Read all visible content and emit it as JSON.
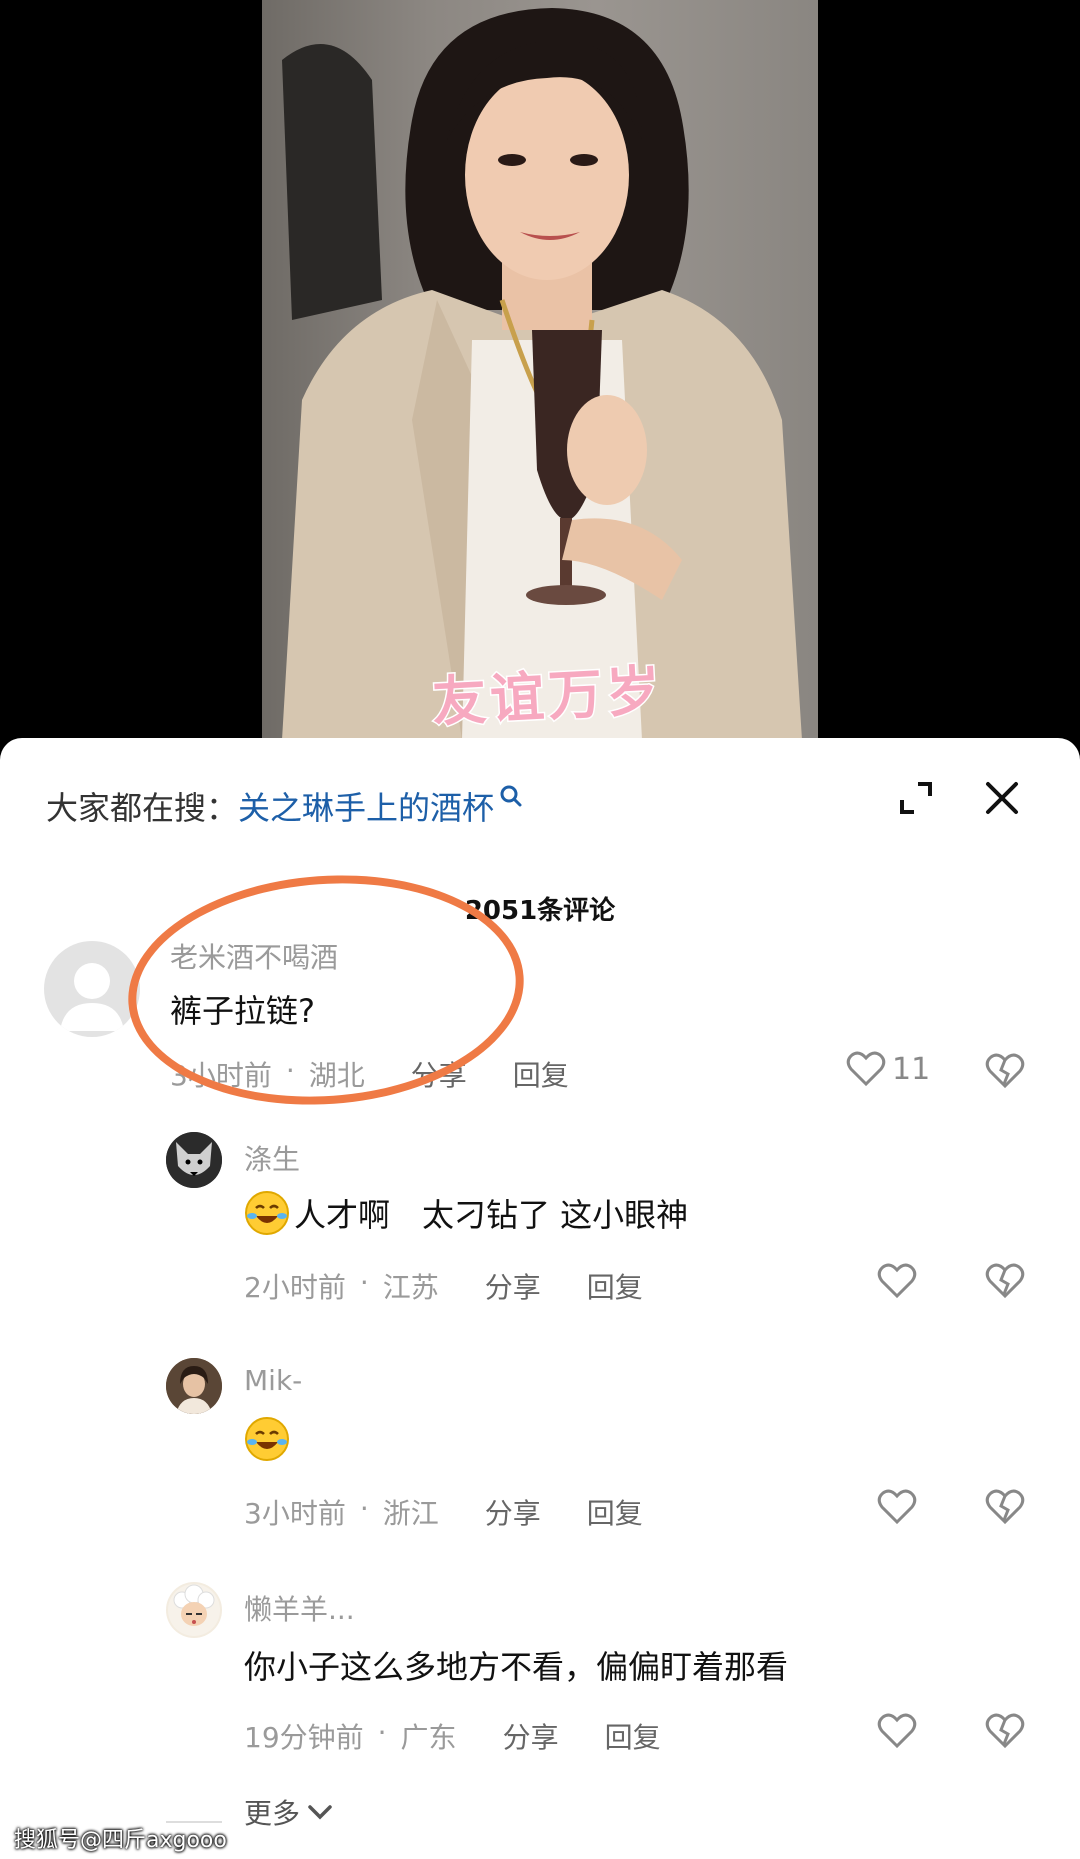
{
  "video": {
    "caption": "友谊万岁"
  },
  "search": {
    "prefix": "大家都在搜：",
    "query": "关之琳手上的酒杯"
  },
  "comments_count": "2051条评论",
  "comments": [
    {
      "user": "老米酒不喝酒",
      "text": "裤子拉链?",
      "time": "3小时前",
      "region": "湖北",
      "share": "分享",
      "reply": "回复",
      "likes": "11"
    },
    {
      "user": "涤生",
      "text": "人才啊　太刁钻了 这小眼神",
      "time": "2小时前",
      "region": "江苏",
      "share": "分享",
      "reply": "回复"
    },
    {
      "user": "Mik-",
      "text": "",
      "time": "3小时前",
      "region": "浙江",
      "share": "分享",
      "reply": "回复"
    },
    {
      "user": "懒羊羊...",
      "text": "你小子这么多地方不看，偏偏盯着那看",
      "time": "19分钟前",
      "region": "广东",
      "share": "分享",
      "reply": "回复"
    }
  ],
  "more_label": "更多",
  "watermark": "搜狐号@四斤axgooo",
  "colors": {
    "accent_link": "#1d5fa8",
    "annotation_ring": "#ef7a45",
    "caption": "#f7a9c0"
  }
}
